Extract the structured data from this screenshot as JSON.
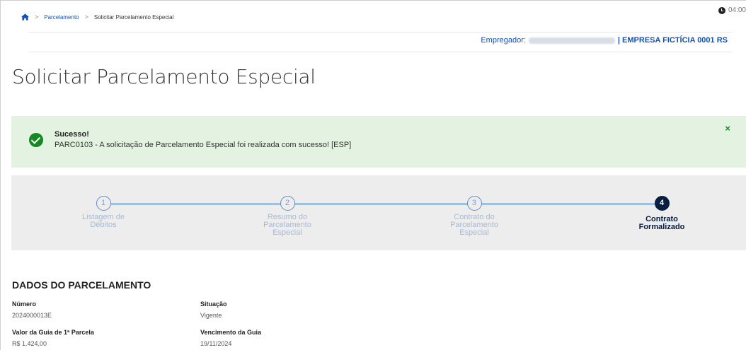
{
  "breadcrumb": {
    "items": [
      "Parcelamento",
      "Solicitar Parcelamento Especial"
    ]
  },
  "clock": {
    "time": "04:00"
  },
  "employer": {
    "label": "Empregador:",
    "name": "| EMPRESA FICTÍCIA 0001 RS"
  },
  "page": {
    "title": "Solicitar Parcelamento Especial"
  },
  "alert": {
    "title": "Sucesso!",
    "message": "PARC0103 - A solicitação de Parcelamento Especial foi realizada com sucesso! [ESP]",
    "close": "×",
    "color": "#168821"
  },
  "stepper": {
    "steps": [
      {
        "number": "1",
        "label": "Listagem de Débitos"
      },
      {
        "number": "2",
        "label": "Resumo do Parcelamento Especial"
      },
      {
        "number": "3",
        "label": "Contrato do Parcelamento Especial"
      },
      {
        "number": "4",
        "label": "Contrato Formalizado"
      }
    ],
    "active_step": 4
  },
  "section": {
    "title": "DADOS DO PARCELAMENTO",
    "fields": {
      "numero": {
        "label": "Número",
        "value": "2024000013E"
      },
      "situacao": {
        "label": "Situação",
        "value": "Vigente"
      },
      "valor": {
        "label": "Valor da Guia de 1ª Parcela",
        "value": "R$ 1.424,00"
      },
      "vencimento": {
        "label": "Vencimento da Guia",
        "value": "19/11/2024"
      }
    }
  },
  "colors": {
    "primary": "#1351b4",
    "dark_blue": "#071d41",
    "success_bg": "#e3f2e1"
  }
}
